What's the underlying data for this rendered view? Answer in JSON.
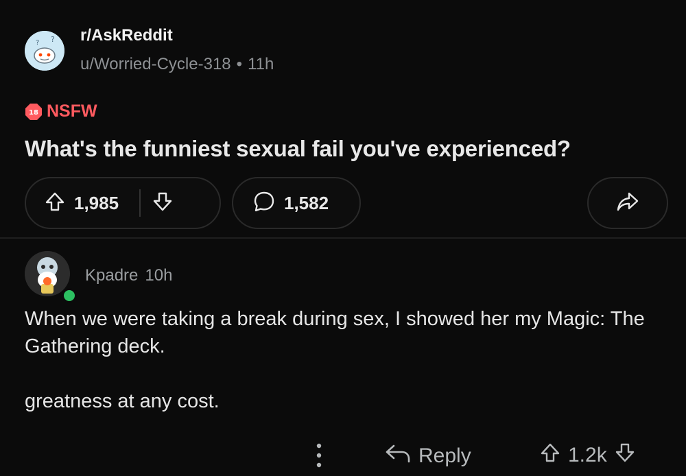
{
  "post": {
    "subreddit": "r/AskReddit",
    "author": "u/Worried-Cycle-318",
    "separator": "•",
    "time": "11h",
    "nsfw_label": "NSFW",
    "nsfw_badge_text": "18",
    "title": "What's the funniest sexual fail you've experienced?",
    "upvotes": "1,985",
    "comments": "1,582"
  },
  "comment": {
    "author": "Kpadre",
    "time": "10h",
    "body_line1": "When we were taking a break during sex, I showed her my Magic: The Gathering deck.",
    "body_line2": "greatness at any cost.",
    "reply_label": "Reply",
    "score": "1.2k"
  },
  "colors": {
    "background": "#0b0b0b",
    "nsfw": "#ff5a5f",
    "online": "#2cc061",
    "text_muted": "#8e9194"
  },
  "icons": [
    "reddit-avatar-icon",
    "nsfw-badge-icon",
    "upvote-icon",
    "downvote-icon",
    "comment-bubble-icon",
    "share-arrow-icon",
    "kebab-menu-icon",
    "reply-arrow-icon"
  ]
}
